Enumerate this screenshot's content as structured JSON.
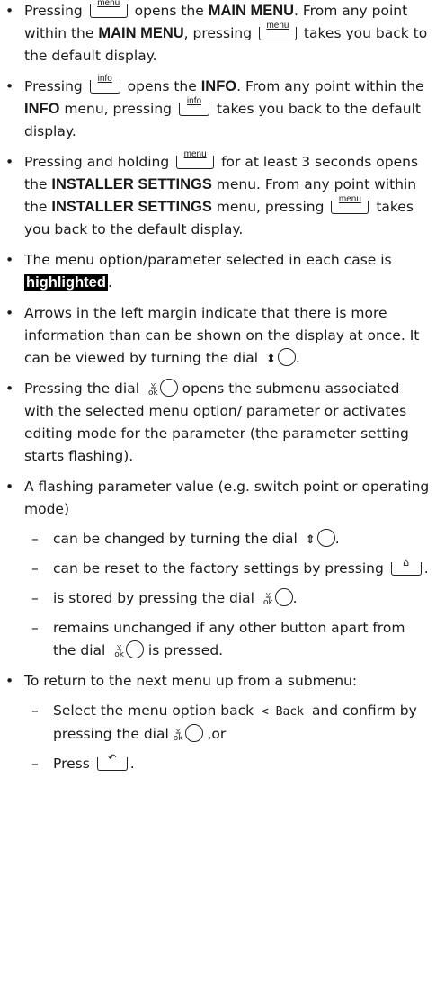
{
  "buttons": {
    "menu": "menu",
    "info": "info"
  },
  "items": [
    {
      "a": "Pressing",
      "b": "opens the",
      "c": "MAIN MENU",
      "d": ". From any point within the",
      "e": "MAIN MENU",
      "f": ", pressing",
      "g": "takes you back to the default display."
    },
    {
      "a": "Pressing",
      "b": "opens the",
      "c": "INFO",
      "d": ". From any point within the",
      "e": "INFO",
      "f": "menu, pressing",
      "g": "takes you back to the default display."
    },
    {
      "a": "Pressing and holding",
      "b": "for at least 3 seconds opens the",
      "c": "INSTALLER SETTINGS",
      "d": "menu. From any point within the",
      "e": "INSTALLER SETTINGS",
      "f": "menu, pressing",
      "g": "takes you back to the default display."
    },
    {
      "a": "The menu option/parameter selected in each case is",
      "hl": "highlighted",
      "b": "."
    },
    {
      "a": "Arrows in the left margin indicate that there is more information than can be shown on the display at once. It can be viewed by turning the dial",
      "b": "."
    },
    {
      "a": "Pressing the dial",
      "b": "opens the submenu associated with the selected menu option/ parameter or activates editing mode for the parameter (the parameter setting starts flashing)."
    },
    {
      "a": "A flashing parameter value (e.g. switch point or operating mode)",
      "sub": [
        {
          "a": "can be changed by turning the dial",
          "b": "."
        },
        {
          "a": "can be reset to the factory settings by pressing",
          "b": "."
        },
        {
          "a": "is stored by pressing the dial",
          "b": "."
        },
        {
          "a": "remains unchanged if any other button apart from the dial",
          "b": "is pressed."
        }
      ]
    },
    {
      "a": "To return to the next menu up from a submenu:",
      "sub": [
        {
          "a": "Select the menu option back",
          "back": "< Back",
          "b": "and confirm by pressing the dial",
          "c": ",or"
        },
        {
          "a": "Press",
          "b": "."
        }
      ]
    }
  ]
}
